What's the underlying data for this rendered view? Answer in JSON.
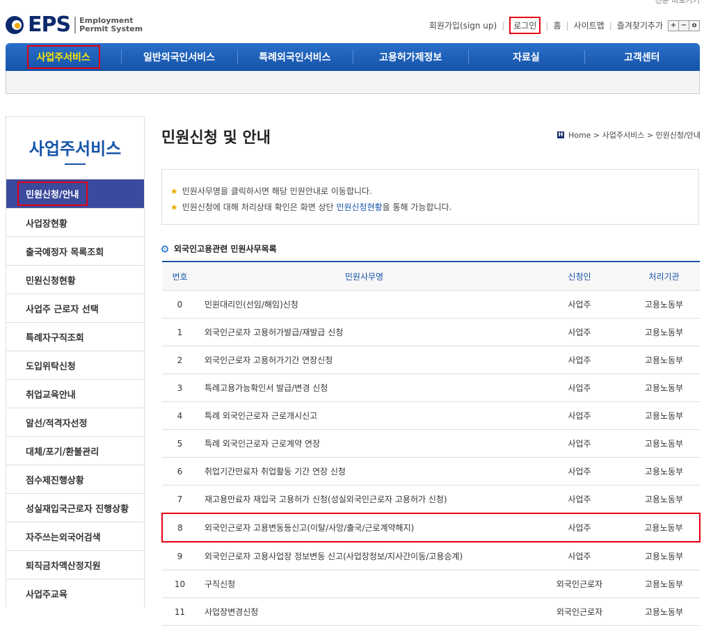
{
  "header": {
    "topcut": "전문 바로가기",
    "logo_text": "EPS",
    "logo_sub1": "Employment",
    "logo_sub2": "Permit System",
    "util": {
      "signup": "회원가입(sign up)",
      "login": "로그인",
      "home": "홈",
      "sitemap": "사이트맵",
      "favorite": "즐겨찾기추가",
      "zoom_in": "+",
      "zoom_out": "−",
      "zoom_reset": "o"
    }
  },
  "gnb": [
    {
      "label": "사업주서비스"
    },
    {
      "label": "일반외국인서비스"
    },
    {
      "label": "특례외국인서비스"
    },
    {
      "label": "고용허가제정보"
    },
    {
      "label": "자료실"
    },
    {
      "label": "고객센터"
    }
  ],
  "lnb": {
    "title": "사업주서비스",
    "items": [
      {
        "label": "민원신청/안내"
      },
      {
        "label": "사업장현황"
      },
      {
        "label": "출국예정자 목록조회"
      },
      {
        "label": "민원신청현황"
      },
      {
        "label": "사업주 근로자 선택"
      },
      {
        "label": "특례자구직조회"
      },
      {
        "label": "도입위탁신청"
      },
      {
        "label": "취업교육안내"
      },
      {
        "label": "알선/적격자선정"
      },
      {
        "label": "대체/포기/환불관리"
      },
      {
        "label": "점수제진행상황"
      },
      {
        "label": "성실재입국근로자 진행상황"
      },
      {
        "label": "자주쓰는외국어검색"
      },
      {
        "label": "퇴직금차액산정지원"
      },
      {
        "label": "사업주교육"
      }
    ]
  },
  "content": {
    "title": "민원신청 및 안내",
    "breadcrumb": {
      "icon": "H",
      "text": "Home > 사업주서비스 > 민원신청/안내"
    },
    "notice": {
      "line1": "민원사무명을 클릭하시면 해당 민원안내로 이동합니다.",
      "line2_a": "민원신청에 대해 처리상태 확인은 화면 상단 ",
      "line2_link": "민원신청현황",
      "line2_b": "을 통해 가능합니다."
    },
    "section_title": "외국인고용관련 민원사무목록",
    "table": {
      "headers": {
        "num": "번호",
        "name": "민원사무명",
        "applicant": "신청인",
        "org": "처리기관"
      },
      "rows": [
        {
          "num": "0",
          "name": "민원대리인(선임/해임)신청",
          "applicant": "사업주",
          "org": "고용노동부"
        },
        {
          "num": "1",
          "name": "외국인근로자 고용허가발급/재발급 신청",
          "applicant": "사업주",
          "org": "고용노동부"
        },
        {
          "num": "2",
          "name": "외국인근로자 고용허가기간 연장신청",
          "applicant": "사업주",
          "org": "고용노동부"
        },
        {
          "num": "3",
          "name": "특례고용가능확인서 발급/변경 신청",
          "applicant": "사업주",
          "org": "고용노동부"
        },
        {
          "num": "4",
          "name": "특례 외국인근로자 근로개시신고",
          "applicant": "사업주",
          "org": "고용노동부"
        },
        {
          "num": "5",
          "name": "특례 외국인근로자 근로계약 연장",
          "applicant": "사업주",
          "org": "고용노동부"
        },
        {
          "num": "6",
          "name": "취업기간만료자 취업활동 기간 연장 신청",
          "applicant": "사업주",
          "org": "고용노동부"
        },
        {
          "num": "7",
          "name": "재고용만료자 재입국 고용허가 신청(성실외국인근로자 고용허가 신청)",
          "applicant": "사업주",
          "org": "고용노동부"
        },
        {
          "num": "8",
          "name": "외국인근로자 고용변동등신고(이탈/사망/출국/근로계약해지)",
          "applicant": "사업주",
          "org": "고용노동부"
        },
        {
          "num": "9",
          "name": "외국인근로자 고용사업장 정보변동 신고(사업장정보/지사간이동/고용승계)",
          "applicant": "사업주",
          "org": "고용노동부"
        },
        {
          "num": "10",
          "name": "구직신청",
          "applicant": "외국인근로자",
          "org": "고용노동부"
        },
        {
          "num": "11",
          "name": "사업장변경신청",
          "applicant": "외국인근로자",
          "org": "고용노동부"
        }
      ]
    }
  }
}
